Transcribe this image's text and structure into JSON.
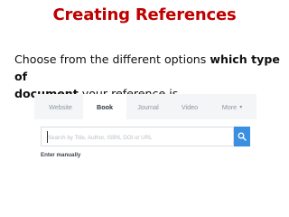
{
  "slide": {
    "title": "Creating References",
    "body_part1": "Choose from the different options ",
    "body_bold1": "which type of",
    "body_bold2": "document",
    "body_part2": " your reference is."
  },
  "widget": {
    "tabs": [
      {
        "label": "Website",
        "active": false
      },
      {
        "label": "Book",
        "active": true
      },
      {
        "label": "Journal",
        "active": false
      },
      {
        "label": "Video",
        "active": false
      },
      {
        "label": "More",
        "active": false
      }
    ],
    "search": {
      "placeholder": "Search by Title, Author, ISBN, DOI or URL",
      "button_icon": "search-icon"
    },
    "enter_manually": "Enter manually"
  },
  "colors": {
    "title": "#c00000",
    "search_button": "#3a8fe0",
    "tab_bar": "#f3f5f7"
  }
}
